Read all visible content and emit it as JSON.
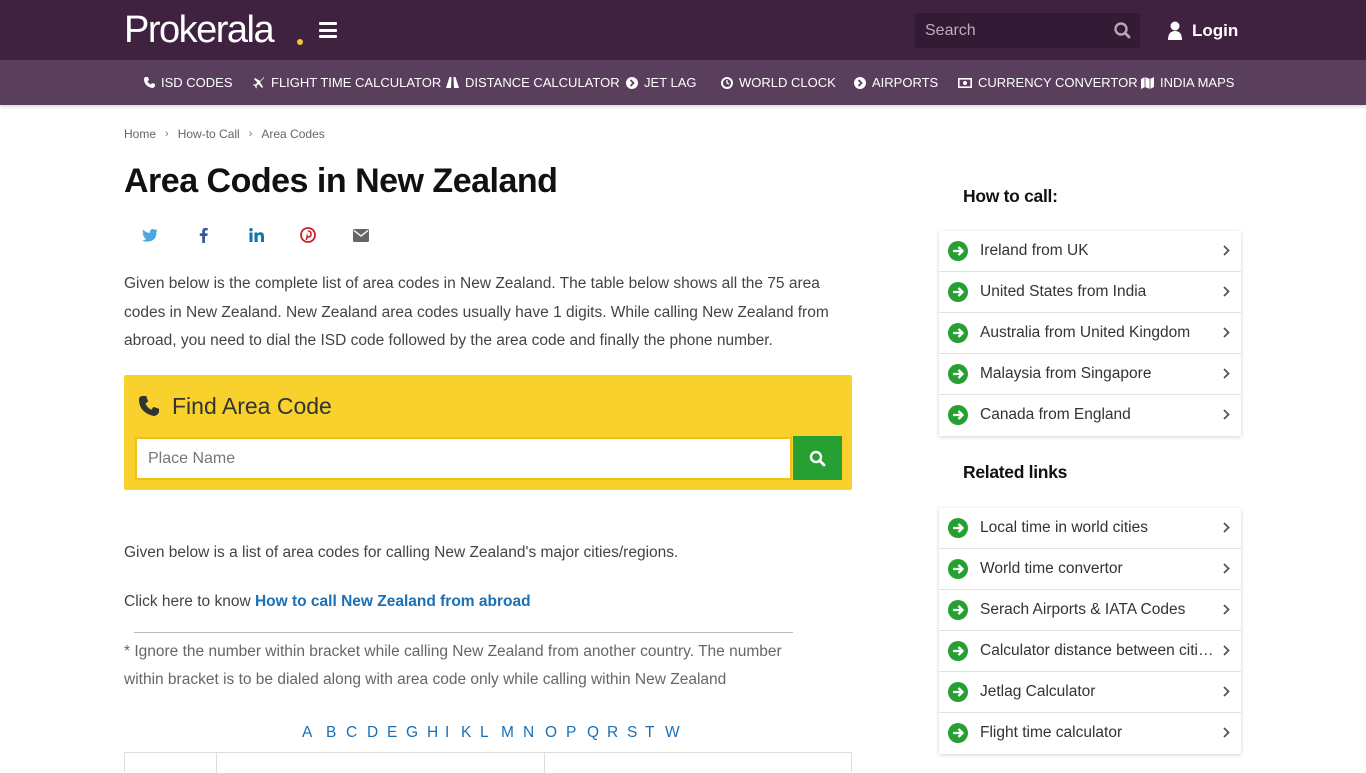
{
  "header": {
    "logo_text": "Prokerala",
    "search_placeholder": "Search",
    "login_label": "Login"
  },
  "nav": [
    {
      "label": "ISD CODES",
      "icon": "phone-icon"
    },
    {
      "label": "FLIGHT TIME CALCULATOR",
      "icon": "plane-icon"
    },
    {
      "label": "DISTANCE CALCULATOR",
      "icon": "road-icon"
    },
    {
      "label": "JET LAG",
      "icon": "arrow-circle-icon"
    },
    {
      "label": "WORLD CLOCK",
      "icon": "clock-icon"
    },
    {
      "label": "AIRPORTS",
      "icon": "arrow-circle-icon"
    },
    {
      "label": "CURRENCY CONVERTOR",
      "icon": "money-icon"
    },
    {
      "label": "INDIA MAPS",
      "icon": "map-icon"
    }
  ],
  "breadcrumb": [
    "Home",
    "How-to Call",
    "Area Codes"
  ],
  "page_title": "Area Codes in New Zealand",
  "share_icons": [
    "twitter-icon",
    "facebook-icon",
    "linkedin-icon",
    "pinterest-icon",
    "email-icon"
  ],
  "intro": "Given below is the complete list of area codes in New Zealand. The table below shows all the 75 area codes in New Zealand. New Zealand area codes usually have 1 digits. While calling New Zealand from abroad, you need to dial the ISD code followed by the area code and finally the phone number.",
  "find": {
    "title": "Find Area Code",
    "placeholder": "Place Name"
  },
  "list_intro": "Given below is a list of area codes for calling New Zealand's major cities/regions.",
  "click_prefix": "Click here to know ",
  "click_link": "How to call New Zealand from abroad",
  "note": "* Ignore the number within bracket while calling New Zealand from another country. The number within bracket is to be dialed along with area code only while calling within New Zealand",
  "alphabet": [
    "A",
    "B",
    "C",
    "D",
    "E",
    "G",
    "H",
    "I",
    "K",
    "L",
    "M",
    "N",
    "O",
    "P",
    "Q",
    "R",
    "S",
    "T",
    "W"
  ],
  "sidebar": {
    "how_to_call_heading": "How to call:",
    "how_to_call": [
      "Ireland from UK",
      "United States from India",
      "Australia from United Kingdom",
      "Malaysia from Singapore",
      "Canada from England"
    ],
    "related_heading": "Related links",
    "related": [
      "Local time in world cities",
      "World time convertor",
      "Serach Airports & IATA Codes",
      "Calculator distance between cities in the world",
      "Jetlag Calculator",
      "Flight time calculator"
    ]
  },
  "colors": {
    "header_bg": "#3e2240",
    "nav_bg": "#5a3f5c",
    "accent_yellow": "#f9d12c",
    "green": "#27a033",
    "link": "#1a6fb5"
  }
}
